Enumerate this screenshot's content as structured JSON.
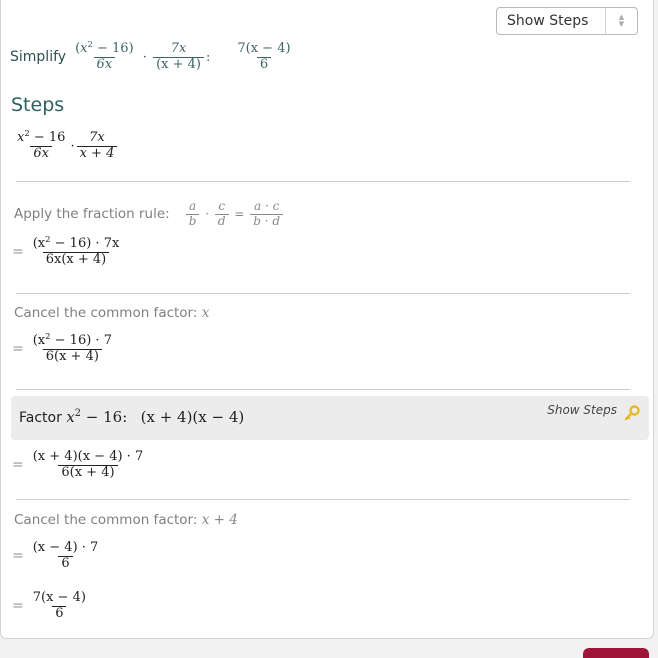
{
  "toolbar": {
    "select_value": "Show Steps"
  },
  "problem": {
    "label": "Simplify",
    "f1_num_x": "x",
    "f1_num_exp": "2",
    "f1_num_rest": "− 16",
    "f1_den": "6x",
    "dot": "·",
    "f2_num": "7x",
    "f2_den": "(x + 4)",
    "colon": ":",
    "answer_num": "7(x − 4)",
    "answer_den": "6"
  },
  "steps_title": "Steps",
  "steps": {
    "initial": {
      "n1": "x",
      "n1_exp": "2",
      "n1_rest": "− 16",
      "d1": "6x",
      "dot": "·",
      "n2": "7x",
      "d2": "x + 4"
    },
    "step1": {
      "description": "Apply the fraction rule:",
      "rule": {
        "a": "a",
        "b": "b",
        "c": "c",
        "d": "d",
        "dot": "·",
        "eq": "=",
        "num": "a · c",
        "den": "b · d"
      },
      "eq": "=",
      "num_pre": "(x",
      "num_exp": "2",
      "num_post": "− 16) · 7x",
      "den": "6x(x + 4)"
    },
    "step2": {
      "description": "Cancel the common factor:",
      "factor": "x",
      "eq": "=",
      "num_pre": "(x",
      "num_exp": "2",
      "num_post": "− 16) · 7",
      "den": "6(x + 4)"
    },
    "step3": {
      "label": "Factor",
      "expr_x": "x",
      "expr_exp": "2",
      "expr_rest": "− 16:",
      "result": "(x + 4)(x − 4)",
      "show_steps": "Show Steps",
      "key_color": "#e8b923"
    },
    "step3_result": {
      "eq": "=",
      "num": "(x + 4)(x − 4) · 7",
      "den": "6(x + 4)"
    },
    "step4": {
      "description": "Cancel the common factor:",
      "factor": "x + 4",
      "eq": "=",
      "num": "(x − 4) · 7",
      "den": "6"
    },
    "final": {
      "eq": "=",
      "num": "7(x − 4)",
      "den": "6"
    }
  }
}
